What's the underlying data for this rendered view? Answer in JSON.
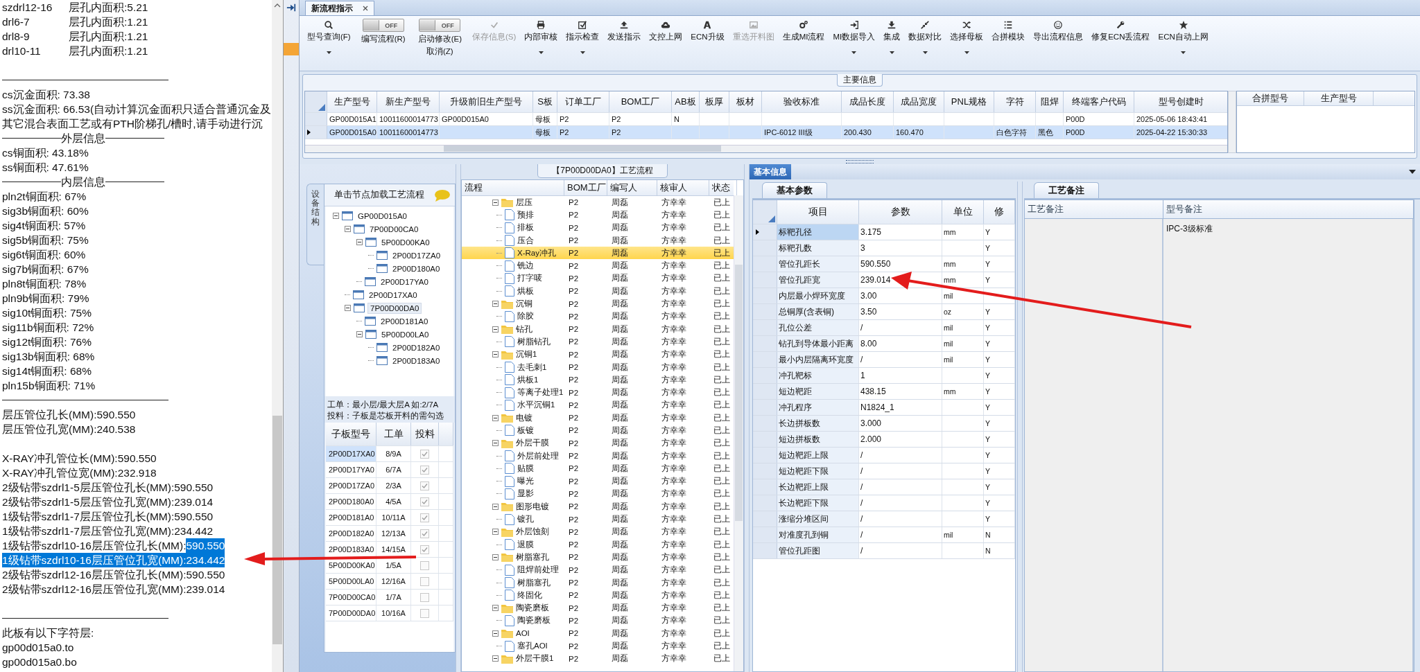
{
  "left_panel": {
    "lines": [
      {
        "kind": "area",
        "name": "szdrl12-16",
        "value": "层孔内面积:5.21"
      },
      {
        "kind": "area",
        "name": "drl6-7",
        "value": "层孔内面积:1.21"
      },
      {
        "kind": "area",
        "name": "drl8-9",
        "value": "层孔内面积:1.21"
      },
      {
        "kind": "area",
        "name": "drl10-11",
        "value": "层孔内面积:1.21"
      },
      {
        "kind": "blank"
      },
      {
        "kind": "rule"
      },
      {
        "kind": "text",
        "text": "cs沉金面积: 73.38"
      },
      {
        "kind": "text",
        "text": "ss沉金面积: 66.53(自动计算沉金面积只适合普通沉金及"
      },
      {
        "kind": "text",
        "text": "其它混合表面工艺或有PTH阶梯孔/槽时,请手动进行沉"
      },
      {
        "kind": "heading",
        "text": "外层信息"
      },
      {
        "kind": "text",
        "text": "cs铜面积: 43.18%"
      },
      {
        "kind": "text",
        "text": "ss铜面积: 47.61%"
      },
      {
        "kind": "heading",
        "text": "内层信息"
      },
      {
        "kind": "text",
        "text": "pln2t铜面积: 67%"
      },
      {
        "kind": "text",
        "text": "sig3b铜面积: 60%"
      },
      {
        "kind": "text",
        "text": "sig4t铜面积: 57%"
      },
      {
        "kind": "text",
        "text": "sig5b铜面积: 75%"
      },
      {
        "kind": "text",
        "text": "sig6t铜面积: 60%"
      },
      {
        "kind": "text",
        "text": "sig7b铜面积: 67%"
      },
      {
        "kind": "text",
        "text": "pln8t铜面积: 78%"
      },
      {
        "kind": "text",
        "text": "pln9b铜面积: 79%"
      },
      {
        "kind": "text",
        "text": "sig10t铜面积: 75%"
      },
      {
        "kind": "text",
        "text": "sig11b铜面积: 72%"
      },
      {
        "kind": "text",
        "text": "sig12t铜面积: 76%"
      },
      {
        "kind": "text",
        "text": "sig13b铜面积: 68%"
      },
      {
        "kind": "text",
        "text": "sig14t铜面积: 68%"
      },
      {
        "kind": "text",
        "text": "pln15b铜面积: 71%"
      },
      {
        "kind": "rule"
      },
      {
        "kind": "measure",
        "label": "层压管位孔长(MM):",
        "value": "590.550",
        "label_selected": false,
        "value_selected": false
      },
      {
        "kind": "measure",
        "label": "层压管位孔宽(MM):",
        "value": "240.538",
        "label_selected": false,
        "value_selected": false
      },
      {
        "kind": "blank"
      },
      {
        "kind": "measure",
        "label": "X-RAY冲孔管位长(MM):",
        "value": "590.550",
        "label_selected": false,
        "value_selected": false
      },
      {
        "kind": "measure",
        "label": "X-RAY冲孔管位宽(MM):",
        "value": "232.918",
        "label_selected": false,
        "value_selected": false
      },
      {
        "kind": "measure",
        "label": "2级钻带szdrl1-5层压管位孔长(MM):",
        "value": "590.550",
        "label_selected": false,
        "value_selected": false
      },
      {
        "kind": "measure",
        "label": "2级钻带szdrl1-5层压管位孔宽(MM):",
        "value": "239.014",
        "label_selected": false,
        "value_selected": false
      },
      {
        "kind": "measure",
        "label": "1级钻带szdrl1-7层压管位孔长(MM):",
        "value": "590.550",
        "label_selected": false,
        "value_selected": false
      },
      {
        "kind": "measure",
        "label": "1级钻带szdrl1-7层压管位孔宽(MM):",
        "value": "234.442",
        "label_selected": false,
        "value_selected": false
      },
      {
        "kind": "measure",
        "label": "1级钻带szdrl10-16层压管位孔长(MM):",
        "value": "590.550",
        "label_selected": false,
        "value_selected": true
      },
      {
        "kind": "measure",
        "label": "1级钻带szdrl10-16层压管位孔宽(MM):",
        "value": "234.442",
        "label_selected": true,
        "value_selected": true
      },
      {
        "kind": "measure",
        "label": "2级钻带szdrl12-16层压管位孔长(MM):",
        "value": "590.550",
        "label_selected": false,
        "value_selected": false
      },
      {
        "kind": "measure",
        "label": "2级钻带szdrl12-16层压管位孔宽(MM):",
        "value": "239.014",
        "label_selected": false,
        "value_selected": false
      },
      {
        "kind": "blank"
      },
      {
        "kind": "rule"
      },
      {
        "kind": "text",
        "text": "此板有以下字符层:"
      },
      {
        "kind": "text",
        "text": "gp00d015a0.to"
      },
      {
        "kind": "text",
        "text": "gp00d015a0.bo"
      }
    ]
  },
  "tabs": [
    {
      "label": "新流程指示",
      "selected": true
    }
  ],
  "toolbar": [
    {
      "kind": "button",
      "label": "型号查询(F)",
      "disabled": false,
      "dropdown": true
    },
    {
      "kind": "toggle",
      "label": "编写流程(R)",
      "switch_text": "OFF",
      "on": false
    },
    {
      "kind": "toggle",
      "label": "启动修改(E)",
      "sublabel": "取消(Z)",
      "switch_text": "OFF",
      "on": false
    },
    {
      "kind": "button",
      "label": "保存信息(S)",
      "disabled": true,
      "dropdown": false
    },
    {
      "kind": "button",
      "label": "内部审核",
      "disabled": false,
      "dropdown": true
    },
    {
      "kind": "button",
      "label": "指示检查",
      "disabled": false,
      "dropdown": true
    },
    {
      "kind": "button",
      "label": "发送指示",
      "disabled": false,
      "dropdown": false
    },
    {
      "kind": "button",
      "label": "文控上网",
      "disabled": false,
      "dropdown": false
    },
    {
      "kind": "button",
      "label": "ECN升级",
      "disabled": false,
      "dropdown": false
    },
    {
      "kind": "button",
      "label": "重选开料图",
      "disabled": true,
      "dropdown": false
    },
    {
      "kind": "button",
      "label": "生成MI流程",
      "disabled": false,
      "dropdown": false
    },
    {
      "kind": "button",
      "label": "MI数据导入",
      "disabled": false,
      "dropdown": true
    },
    {
      "kind": "button",
      "label": "集成",
      "disabled": false,
      "dropdown": true
    },
    {
      "kind": "button",
      "label": "数据对比",
      "disabled": false,
      "dropdown": true
    },
    {
      "kind": "button",
      "label": "选择母板",
      "disabled": false,
      "dropdown": true
    },
    {
      "kind": "button",
      "label": "合拼模块",
      "disabled": false,
      "dropdown": false
    },
    {
      "kind": "button",
      "label": "导出流程信息",
      "disabled": false,
      "dropdown": false
    },
    {
      "kind": "button",
      "label": "修复ECN丢流程",
      "disabled": false,
      "dropdown": false
    },
    {
      "kind": "button",
      "label": "ECN自动上网",
      "disabled": false,
      "dropdown": true
    }
  ],
  "main_info": {
    "title": "主要信息",
    "columns": [
      "生产型号",
      "新生产型号",
      "升级前旧生产型号",
      "S板",
      "订单工厂",
      "BOM工厂",
      "AB板",
      "板厚",
      "板材",
      "验收标准",
      "成品长度",
      "成品宽度",
      "PNL规格",
      "字符",
      "阻焊",
      "终端客户代码",
      "型号创建时"
    ],
    "rows": [
      {
        "selected": false,
        "cells": [
          "GP00D015A1",
          "10011600014773",
          "GP00D015A0",
          "母板",
          "P2",
          "P2",
          "N",
          "",
          "",
          "",
          "",
          "",
          "",
          "",
          "",
          "P00D",
          "2025-05-06 18:43:41"
        ]
      },
      {
        "selected": true,
        "cells": [
          "GP00D015A0",
          "10011600014773",
          "",
          "母板",
          "P2",
          "P2",
          "",
          "",
          "",
          "IPC-6012 III级",
          "200.430",
          "160.470",
          "",
          "白色字符",
          "黑色",
          "P00D",
          "2025-04-22 15:30:33"
        ]
      }
    ],
    "merge_columns": [
      "合拼型号",
      "生产型号"
    ]
  },
  "structure": {
    "side_tab": "设备结构",
    "hint": "单击节点加载工艺流程",
    "tree": [
      {
        "label": "GP00D015A0",
        "expanded": true,
        "selected": false,
        "children": [
          {
            "label": "7P00D00CA0",
            "expanded": true,
            "selected": false,
            "children": [
              {
                "label": "5P00D00KA0",
                "expanded": true,
                "selected": false,
                "children": [
                  {
                    "label": "2P00D17ZA0",
                    "selected": false
                  },
                  {
                    "label": "2P00D180A0",
                    "selected": false
                  }
                ]
              },
              {
                "label": "2P00D17YA0",
                "selected": false
              }
            ]
          },
          {
            "label": "2P00D17XA0",
            "selected": false
          },
          {
            "label": "7P00D00DA0",
            "expanded": true,
            "selected": true,
            "children": [
              {
                "label": "2P00D181A0",
                "selected": false
              },
              {
                "label": "5P00D00LA0",
                "expanded": true,
                "selected": false,
                "children": [
                  {
                    "label": "2P00D182A0",
                    "selected": false
                  },
                  {
                    "label": "2P00D183A0",
                    "selected": false
                  }
                ]
              }
            ]
          }
        ]
      }
    ],
    "notes": [
      "工单：最小层/最大层A 如:2/7A",
      "投料：子板是芯板开料的需勾选"
    ],
    "columns": [
      "子板型号",
      "工单",
      "投料"
    ],
    "rows": [
      {
        "board": "2P00D17XA0",
        "order": "8/9A",
        "checked": true,
        "selected": true
      },
      {
        "board": "2P00D17YA0",
        "order": "6/7A",
        "checked": true,
        "selected": false
      },
      {
        "board": "2P00D17ZA0",
        "order": "2/3A",
        "checked": true,
        "selected": false
      },
      {
        "board": "2P00D180A0",
        "order": "4/5A",
        "checked": true,
        "selected": false
      },
      {
        "board": "2P00D181A0",
        "order": "10/11A",
        "checked": true,
        "selected": false
      },
      {
        "board": "2P00D182A0",
        "order": "12/13A",
        "checked": true,
        "selected": false
      },
      {
        "board": "2P00D183A0",
        "order": "14/15A",
        "checked": true,
        "selected": false
      },
      {
        "board": "5P00D00KA0",
        "order": "1/5A",
        "checked": false,
        "selected": false
      },
      {
        "board": "5P00D00LA0",
        "order": "12/16A",
        "checked": false,
        "selected": false
      },
      {
        "board": "7P00D00CA0",
        "order": "1/7A",
        "checked": false,
        "selected": false
      },
      {
        "board": "7P00D00DA0",
        "order": "10/16A",
        "checked": false,
        "selected": false
      }
    ]
  },
  "process": {
    "title": "【7P00D00DA0】工艺流程",
    "columns": [
      "流程",
      "BOM工厂",
      "编写人",
      "核审人",
      "状态"
    ],
    "groups": [
      {
        "name": "层压",
        "bom": "P2",
        "writer": "周磊",
        "reviewer": "方幸幸",
        "status": "已上",
        "expanded": true,
        "selected": false,
        "children": [
          {
            "name": "预排",
            "bom": "P2",
            "writer": "周磊",
            "reviewer": "方幸幸",
            "status": "已上",
            "selected": false
          },
          {
            "name": "排板",
            "bom": "P2",
            "writer": "周磊",
            "reviewer": "方幸幸",
            "status": "已上",
            "selected": false
          },
          {
            "name": "压合",
            "bom": "P2",
            "writer": "周磊",
            "reviewer": "方幸幸",
            "status": "已上",
            "selected": false
          },
          {
            "name": "X-Ray冲孔",
            "bom": "P2",
            "writer": "周磊",
            "reviewer": "方幸幸",
            "status": "已上",
            "selected": true
          },
          {
            "name": "铣边",
            "bom": "P2",
            "writer": "周磊",
            "reviewer": "方幸幸",
            "status": "已上",
            "selected": false
          },
          {
            "name": "打字唛",
            "bom": "P2",
            "writer": "周磊",
            "reviewer": "方幸幸",
            "status": "已上",
            "selected": false
          },
          {
            "name": "烘板",
            "bom": "P2",
            "writer": "周磊",
            "reviewer": "方幸幸",
            "status": "已上",
            "selected": false
          }
        ]
      },
      {
        "name": "沉铜",
        "bom": "P2",
        "writer": "周磊",
        "reviewer": "方幸幸",
        "status": "已上",
        "expanded": true,
        "selected": false,
        "children": [
          {
            "name": "除胶",
            "bom": "P2",
            "writer": "周磊",
            "reviewer": "方幸幸",
            "status": "已上",
            "selected": false
          }
        ]
      },
      {
        "name": "钻孔",
        "bom": "P2",
        "writer": "周磊",
        "reviewer": "方幸幸",
        "status": "已上",
        "expanded": true,
        "selected": false,
        "children": [
          {
            "name": "树脂钻孔",
            "bom": "P2",
            "writer": "周磊",
            "reviewer": "方幸幸",
            "status": "已上",
            "selected": false
          }
        ]
      },
      {
        "name": "沉铜1",
        "bom": "P2",
        "writer": "周磊",
        "reviewer": "方幸幸",
        "status": "已上",
        "expanded": true,
        "selected": false,
        "children": [
          {
            "name": "去毛刺1",
            "bom": "P2",
            "writer": "周磊",
            "reviewer": "方幸幸",
            "status": "已上",
            "selected": false
          },
          {
            "name": "烘板1",
            "bom": "P2",
            "writer": "周磊",
            "reviewer": "方幸幸",
            "status": "已上",
            "selected": false
          },
          {
            "name": "等离子处理1",
            "bom": "P2",
            "writer": "周磊",
            "reviewer": "方幸幸",
            "status": "已上",
            "selected": false
          },
          {
            "name": "水平沉铜1",
            "bom": "P2",
            "writer": "周磊",
            "reviewer": "方幸幸",
            "status": "已上",
            "selected": false
          }
        ]
      },
      {
        "name": "电镀",
        "bom": "P2",
        "writer": "周磊",
        "reviewer": "方幸幸",
        "status": "已上",
        "expanded": true,
        "selected": false,
        "children": [
          {
            "name": "板镀",
            "bom": "P2",
            "writer": "周磊",
            "reviewer": "方幸幸",
            "status": "已上",
            "selected": false
          }
        ]
      },
      {
        "name": "外层干膜",
        "bom": "P2",
        "writer": "周磊",
        "reviewer": "方幸幸",
        "status": "已上",
        "expanded": true,
        "selected": false,
        "children": [
          {
            "name": "外层前处理",
            "bom": "P2",
            "writer": "周磊",
            "reviewer": "方幸幸",
            "status": "已上",
            "selected": false
          },
          {
            "name": "贴膜",
            "bom": "P2",
            "writer": "周磊",
            "reviewer": "方幸幸",
            "status": "已上",
            "selected": false
          },
          {
            "name": "曝光",
            "bom": "P2",
            "writer": "周磊",
            "reviewer": "方幸幸",
            "status": "已上",
            "selected": false
          },
          {
            "name": "显影",
            "bom": "P2",
            "writer": "周磊",
            "reviewer": "方幸幸",
            "status": "已上",
            "selected": false
          }
        ]
      },
      {
        "name": "图形电镀",
        "bom": "P2",
        "writer": "周磊",
        "reviewer": "方幸幸",
        "status": "已上",
        "expanded": true,
        "selected": false,
        "children": [
          {
            "name": "镀孔",
            "bom": "P2",
            "writer": "周磊",
            "reviewer": "方幸幸",
            "status": "已上",
            "selected": false
          }
        ]
      },
      {
        "name": "外层蚀刻",
        "bom": "P2",
        "writer": "周磊",
        "reviewer": "方幸幸",
        "status": "已上",
        "expanded": true,
        "selected": false,
        "children": [
          {
            "name": "退膜",
            "bom": "P2",
            "writer": "周磊",
            "reviewer": "方幸幸",
            "status": "已上",
            "selected": false
          }
        ]
      },
      {
        "name": "树脂塞孔",
        "bom": "P2",
        "writer": "周磊",
        "reviewer": "方幸幸",
        "status": "已上",
        "expanded": true,
        "selected": false,
        "children": [
          {
            "name": "阻焊前处理",
            "bom": "P2",
            "writer": "周磊",
            "reviewer": "方幸幸",
            "status": "已上",
            "selected": false
          },
          {
            "name": "树脂塞孔",
            "bom": "P2",
            "writer": "周磊",
            "reviewer": "方幸幸",
            "status": "已上",
            "selected": false
          },
          {
            "name": "终固化",
            "bom": "P2",
            "writer": "周磊",
            "reviewer": "方幸幸",
            "status": "已上",
            "selected": false
          }
        ]
      },
      {
        "name": "陶瓷磨板",
        "bom": "P2",
        "writer": "周磊",
        "reviewer": "方幸幸",
        "status": "已上",
        "expanded": true,
        "selected": false,
        "children": [
          {
            "name": "陶瓷磨板",
            "bom": "P2",
            "writer": "周磊",
            "reviewer": "方幸幸",
            "status": "已上",
            "selected": false
          }
        ]
      },
      {
        "name": "AOI",
        "bom": "P2",
        "writer": "周磊",
        "reviewer": "方幸幸",
        "status": "已上",
        "expanded": true,
        "selected": false,
        "children": [
          {
            "name": "塞孔AOI",
            "bom": "P2",
            "writer": "周磊",
            "reviewer": "方幸幸",
            "status": "已上",
            "selected": false
          }
        ]
      },
      {
        "name": "外层干膜1",
        "bom": "P2",
        "writer": "周磊",
        "reviewer": "方幸幸",
        "status": "已上",
        "expanded": true,
        "selected": false
      }
    ]
  },
  "basic_info": {
    "tabs": [
      {
        "label": "基本信息",
        "selected": true
      }
    ],
    "params_tab": "基本参数",
    "params_columns": [
      "项目",
      "参数",
      "单位",
      "修"
    ],
    "params": [
      {
        "item": "标靶孔径",
        "value": "3.175",
        "unit": "mm",
        "modified": "Y",
        "selected": true
      },
      {
        "item": "标靶孔数",
        "value": "3",
        "modified": "Y",
        "selected": false
      },
      {
        "item": "管位孔距长",
        "value": "590.550",
        "unit": "mm",
        "modified": "Y",
        "selected": false
      },
      {
        "item": "管位孔距宽",
        "value": "239.014",
        "unit": "mm",
        "modified": "Y",
        "selected": false
      },
      {
        "item": "内层最小焊环宽度",
        "value": "3.00",
        "unit": "mil",
        "selected": false
      },
      {
        "item": "总铜厚(含表铜)",
        "value": "3.50",
        "unit": "oz",
        "modified": "Y",
        "selected": false
      },
      {
        "item": "孔位公差",
        "value": "/",
        "unit": "mil",
        "modified": "Y",
        "selected": false
      },
      {
        "item": "钻孔到导体最小距离",
        "value": "8.00",
        "unit": "mil",
        "modified": "Y",
        "selected": false
      },
      {
        "item": "最小内层隔离环宽度",
        "value": "/",
        "unit": "mil",
        "modified": "Y",
        "selected": false
      },
      {
        "item": "冲孔靶标",
        "value": "1",
        "modified": "Y",
        "selected": false
      },
      {
        "item": "短边靶距",
        "value": "438.15",
        "unit": "mm",
        "modified": "Y",
        "selected": false
      },
      {
        "item": "冲孔程序",
        "value": "N1824_1",
        "modified": "Y",
        "selected": false
      },
      {
        "item": "长边拼板数",
        "value": "3.000",
        "modified": "Y",
        "selected": false
      },
      {
        "item": "短边拼板数",
        "value": "2.000",
        "modified": "Y",
        "selected": false
      },
      {
        "item": "短边靶距上限",
        "value": "/",
        "modified": "Y",
        "selected": false
      },
      {
        "item": "短边靶距下限",
        "value": "/",
        "modified": "Y",
        "selected": false
      },
      {
        "item": "长边靶距上限",
        "value": "/",
        "modified": "Y",
        "selected": false
      },
      {
        "item": "长边靶距下限",
        "value": "/",
        "modified": "Y",
        "selected": false
      },
      {
        "item": "涨缩分堆区间",
        "value": "/",
        "modified": "Y",
        "selected": false
      },
      {
        "item": "对准度孔到铜",
        "value": "/",
        "unit": "mil",
        "modified": "N",
        "selected": false
      },
      {
        "item": "管位孔距图",
        "value": "/",
        "modified": "N",
        "selected": false
      }
    ],
    "notes_tab": "工艺备注",
    "notes_columns": [
      "工艺备注",
      "型号备注"
    ],
    "model_note": "IPC-3级标准"
  }
}
